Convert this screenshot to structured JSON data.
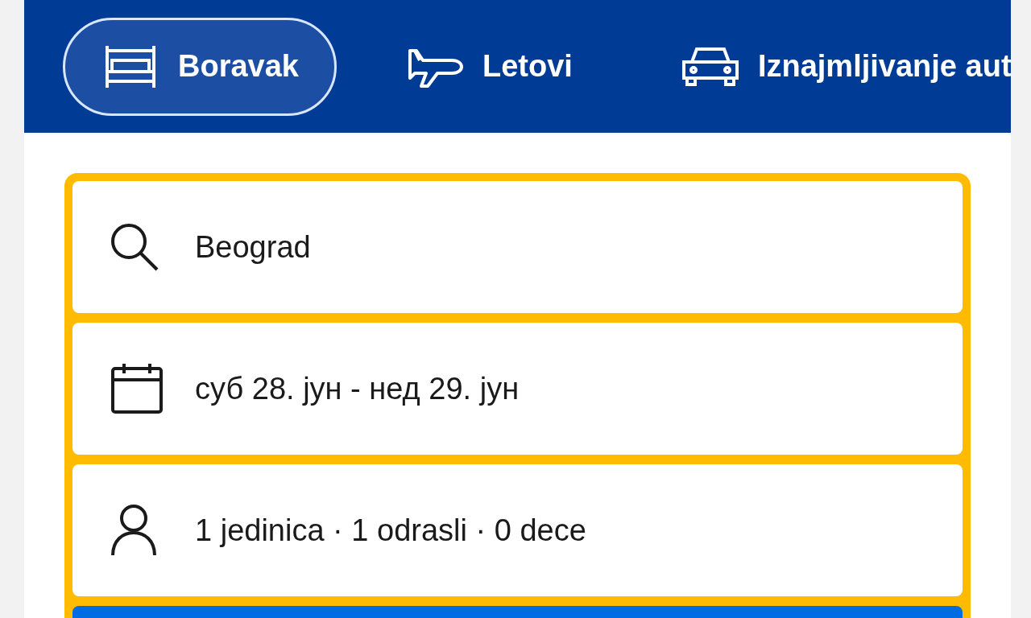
{
  "tabs": [
    {
      "label": "Boravak",
      "kind": "bed",
      "selected": true
    },
    {
      "label": "Letovi",
      "kind": "plane",
      "selected": false
    },
    {
      "label": "Iznajmljivanje aut",
      "kind": "car",
      "selected": false
    }
  ],
  "fields": [
    {
      "kind": "search",
      "value": "Beograd"
    },
    {
      "kind": "date",
      "value": "суб 28. јун - нед 29. јун"
    },
    {
      "kind": "guests",
      "value": "1 jedinica · 1 odrasli · 0 dece"
    }
  ]
}
